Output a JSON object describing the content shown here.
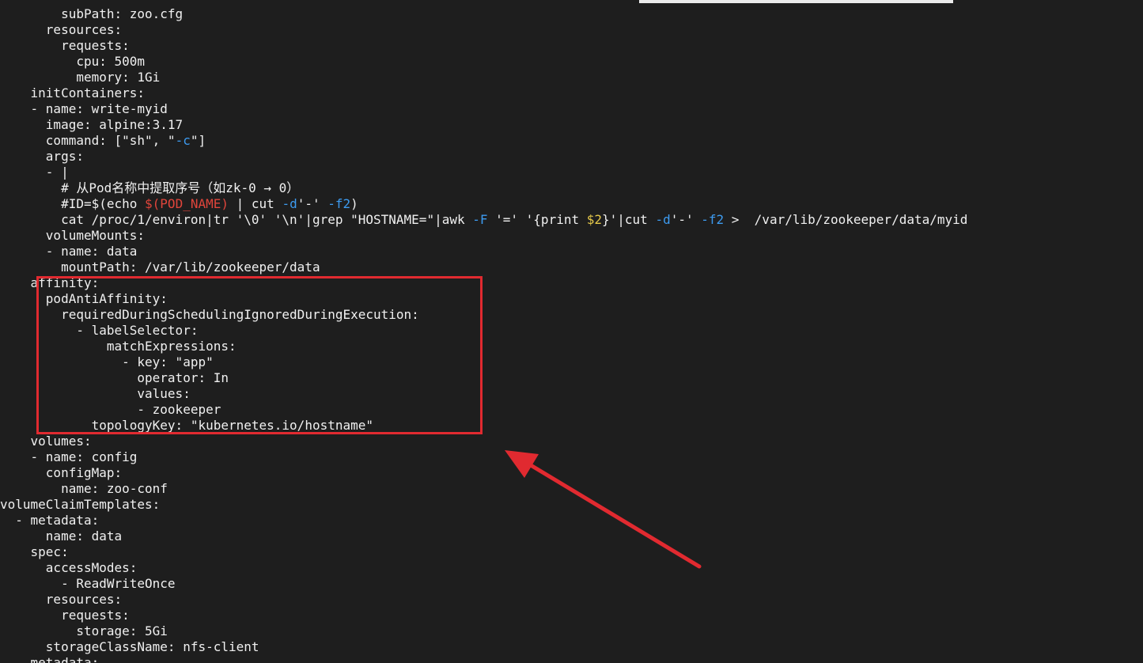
{
  "editor": {
    "lines": [
      [
        {
          "t": "        subPath: zoo.cfg"
        }
      ],
      [
        {
          "t": "      resources:"
        }
      ],
      [
        {
          "t": "        requests:"
        }
      ],
      [
        {
          "t": "          cpu: 500m"
        }
      ],
      [
        {
          "t": "          memory: 1Gi"
        }
      ],
      [
        {
          "t": "    initContainers:"
        }
      ],
      [
        {
          "t": "    - name: write-myid"
        }
      ],
      [
        {
          "t": "      image: alpine:3.17"
        }
      ],
      [
        {
          "t": "      command: [\"sh\", \""
        },
        {
          "t": "-c",
          "c": "t-blue"
        },
        {
          "t": "\"]"
        }
      ],
      [
        {
          "t": "      args:"
        }
      ],
      [
        {
          "t": "      - |"
        }
      ],
      [
        {
          "t": "        # 从Pod名称中提取序号（如zk-0 → 0）"
        }
      ],
      [
        {
          "t": "        #ID=$(echo "
        },
        {
          "t": "$(POD_NAME)",
          "c": "t-red"
        },
        {
          "t": " | cut "
        },
        {
          "t": "-d",
          "c": "t-blue"
        },
        {
          "t": "'-' "
        },
        {
          "t": "-f2",
          "c": "t-blue"
        },
        {
          "t": ")"
        }
      ],
      [
        {
          "t": "        cat /proc/1/environ|tr '\\0' '\\n'|grep \"HOSTNAME=\"|awk "
        },
        {
          "t": "-F",
          "c": "t-blue"
        },
        {
          "t": " '=' '{print "
        },
        {
          "t": "$2",
          "c": "t-yellow"
        },
        {
          "t": "}'|cut "
        },
        {
          "t": "-d",
          "c": "t-blue"
        },
        {
          "t": "'-' "
        },
        {
          "t": "-f2",
          "c": "t-blue"
        },
        {
          "t": " >  /var/lib/zookeeper/data/myid"
        }
      ],
      [
        {
          "t": "      volumeMounts:"
        }
      ],
      [
        {
          "t": "      - name: data"
        }
      ],
      [
        {
          "t": "        mountPath: /var/lib/zookeeper/data"
        }
      ],
      [
        {
          "t": "    affinity:"
        }
      ],
      [
        {
          "t": "      podAntiAffinity:"
        }
      ],
      [
        {
          "t": "        requiredDuringSchedulingIgnoredDuringExecution:"
        }
      ],
      [
        {
          "t": "          - labelSelector:"
        }
      ],
      [
        {
          "t": "              matchExpressions:"
        }
      ],
      [
        {
          "t": "                - key: \"app\""
        }
      ],
      [
        {
          "t": "                  operator: In"
        }
      ],
      [
        {
          "t": "                  values:"
        }
      ],
      [
        {
          "t": "                  - zookeeper"
        }
      ],
      [
        {
          "t": "            topologyKey: \"kubernetes.io/hostname\""
        }
      ],
      [
        {
          "t": "    volumes:"
        }
      ],
      [
        {
          "t": "    - name: config"
        }
      ],
      [
        {
          "t": "      configMap:"
        }
      ],
      [
        {
          "t": "        name: zoo-conf"
        }
      ],
      [
        {
          "t": "volumeClaimTemplates:"
        }
      ],
      [
        {
          "t": "  - metadata:"
        }
      ],
      [
        {
          "t": "      name: data"
        }
      ],
      [
        {
          "t": "    spec:"
        }
      ],
      [
        {
          "t": "      accessModes:"
        }
      ],
      [
        {
          "t": "        - ReadWriteOnce"
        }
      ],
      [
        {
          "t": "      resources:"
        }
      ],
      [
        {
          "t": "        requests:"
        }
      ],
      [
        {
          "t": "          storage: 5Gi"
        }
      ],
      [
        {
          "t": "      storageClassName: nfs-client"
        }
      ],
      [
        {
          "t": "    metadata:"
        }
      ]
    ]
  },
  "colors": {
    "background": "#1e1e1e",
    "text": "#f0f0f0",
    "flag": "#3d9bf0",
    "variable": "#e0453b",
    "field": "#e6c94a",
    "annotation": "#e12a30"
  }
}
